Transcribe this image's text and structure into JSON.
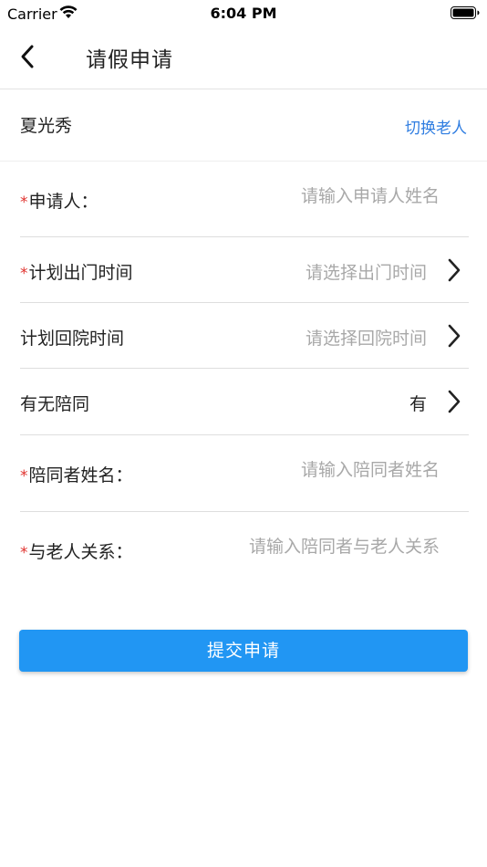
{
  "status_bar": {
    "carrier": "Carrier",
    "time": "6:04 PM"
  },
  "nav": {
    "title": "请假申请",
    "back_icon": "chevron-left-icon"
  },
  "elder": {
    "name": "夏光秀",
    "switch_label": "切换老人"
  },
  "form": {
    "applicant": {
      "label": "申请人：",
      "required": "*",
      "placeholder": "请输入申请人姓名"
    },
    "departure_time": {
      "label": "计划出门时间",
      "required": "*",
      "placeholder": "请选择出门时间"
    },
    "return_time": {
      "label": "计划回院时间",
      "placeholder": "请选择回院时间"
    },
    "companion": {
      "label": "有无陪同",
      "value": "有"
    },
    "companion_name": {
      "label": "陪同者姓名：",
      "required": "*",
      "placeholder": "请输入陪同者姓名"
    },
    "relationship": {
      "label": "与老人关系：",
      "required": "*",
      "placeholder": "请输入陪同者与老人关系"
    }
  },
  "submit_label": "提交申请",
  "colors": {
    "accent": "#2196f3",
    "link": "#2f7de1",
    "required": "#e0322e",
    "placeholder": "#a8a8a8"
  }
}
